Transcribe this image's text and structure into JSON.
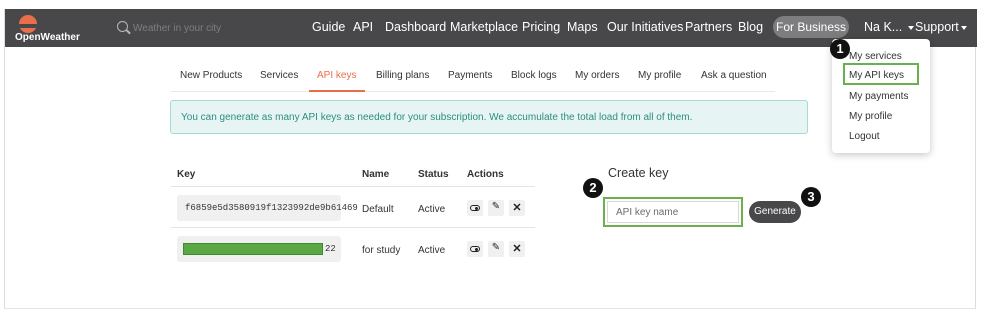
{
  "brand": {
    "name": "OpenWeather",
    "color": "#eb6e4b"
  },
  "search": {
    "placeholder": "Weather in your city"
  },
  "nav": {
    "links": [
      "Guide",
      "API",
      "Dashboard",
      "Marketplace",
      "Pricing",
      "Maps",
      "Our Initiatives",
      "Partners",
      "Blog"
    ],
    "business_button": "For Business",
    "user_menu": "Na K...",
    "support_menu": "Support"
  },
  "user_dropdown": {
    "items": [
      "My services",
      "My API keys",
      "My payments",
      "My profile",
      "Logout"
    ],
    "highlighted": "My API keys"
  },
  "tabs": {
    "items": [
      "New Products",
      "Services",
      "API keys",
      "Billing plans",
      "Payments",
      "Block logs",
      "My orders",
      "My profile",
      "Ask a question"
    ],
    "active": "API keys"
  },
  "info_message": "You can generate as many API keys as needed for your subscription. We accumulate the total load from all of them.",
  "keys_table": {
    "headers": {
      "key": "Key",
      "name": "Name",
      "status": "Status",
      "actions": "Actions"
    },
    "rows": [
      {
        "key": "f6859e5d3580919f1323992de9b61469",
        "name": "Default",
        "status": "Active",
        "masked": false
      },
      {
        "key_suffix": "22",
        "name": "for study",
        "status": "Active",
        "masked": true
      }
    ],
    "action_icons": [
      "toggle-icon",
      "edit-icon",
      "delete-icon"
    ]
  },
  "create_key": {
    "title": "Create key",
    "input_placeholder": "API key name",
    "button_label": "Generate"
  },
  "annotations": {
    "step1": "1",
    "step2": "2",
    "step3": "3"
  },
  "colors": {
    "navbar": "#48484a",
    "accent": "#eb6e4b",
    "highlight_border": "#6ab04c",
    "info_bg": "#e6f5f3",
    "info_text": "#2e8c84"
  }
}
